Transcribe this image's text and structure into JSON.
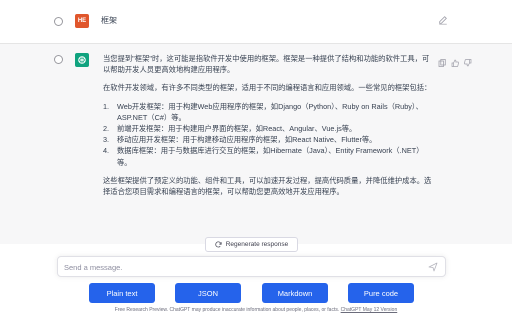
{
  "user_message": {
    "avatar_text": "HE",
    "text": "框架"
  },
  "assistant_message": {
    "intro": "当您提到\"框架\"时，这可能是指软件开发中使用的框架。框架是一种提供了结构和功能的软件工具，可以帮助开发人员更高效地构建应用程序。",
    "context": "在软件开发领域，有许多不同类型的框架，适用于不同的编程语言和应用领域。一些常见的框架包括：",
    "list": [
      {
        "num": "1.",
        "text": "Web开发框架：用于构建Web应用程序的框架，如Django（Python）、Ruby on Rails（Ruby）、ASP.NET（C#）等。"
      },
      {
        "num": "2.",
        "text": "前端开发框架：用于构建用户界面的框架，如React、Angular、Vue.js等。"
      },
      {
        "num": "3.",
        "text": "移动应用开发框架：用于构建移动应用程序的框架，如React Native、Flutter等。"
      },
      {
        "num": "4.",
        "text": "数据库框架：用于与数据库进行交互的框架，如Hibernate（Java）、Entity Framework（.NET）等。"
      }
    ],
    "conclusion": "这些框架提供了预定义的功能、组件和工具，可以加速开发过程，提高代码质量，并降低维护成本。选择适合您项目需求和编程语言的框架，可以帮助您更高效地开发应用程序。"
  },
  "regenerate_label": "Regenerate response",
  "composer": {
    "placeholder": "Send a message."
  },
  "buttons": {
    "plain": "Plain text",
    "json": "JSON",
    "markdown": "Markdown",
    "code": "Pure code"
  },
  "footer": {
    "text": "Free Research Preview. ChatGPT may produce inaccurate information about people, places, or facts.",
    "link": "ChatGPT May 12 Version"
  },
  "colors": {
    "user_avatar": "#e0562c",
    "gpt_avatar": "#10a37f",
    "button": "#2563eb"
  },
  "icons": [
    "edit-icon",
    "openai-logo-icon",
    "copy-icon",
    "thumbs-up-icon",
    "thumbs-down-icon",
    "refresh-icon",
    "send-icon"
  ]
}
